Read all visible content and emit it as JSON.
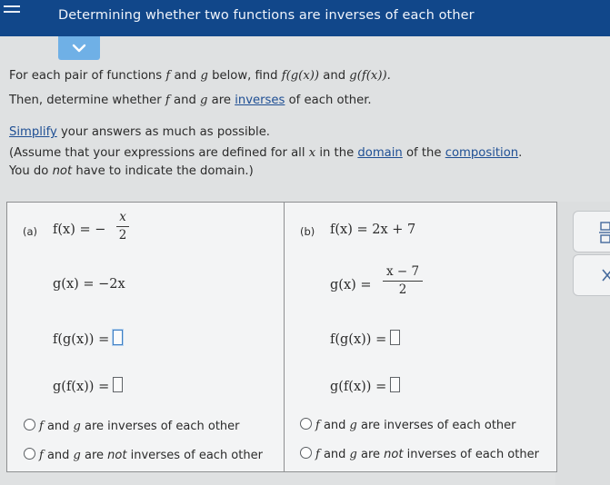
{
  "header": {
    "title": "Determining whether two functions are inverses of each other"
  },
  "intro": {
    "line1_a": "For each pair of functions ",
    "f": "f",
    "and": " and ",
    "g": "g",
    "line1_b": " below, find ",
    "fg_expr": "f(g(x))",
    "line1_c": " and ",
    "gf_expr": "g(f(x)).",
    "line2_a": "Then, determine whether ",
    "line2_b": " are ",
    "inverses_link": "inverses",
    "line2_c": " of each other."
  },
  "notes": {
    "simplify_link": "Simplify",
    "simplify_rest": " your answers as much as possible.",
    "assume_a": "(Assume that your expressions are defined for all ",
    "x": "x",
    "assume_b": " in the ",
    "domain_link": "domain",
    "assume_c": " of the ",
    "composition_link": "composition",
    "assume_d": ".",
    "line3_a": "You do ",
    "not": "not",
    "line3_b": " have to indicate the domain.)"
  },
  "part_a": {
    "tag": "(a)",
    "f_def": "f(x) = −",
    "f_num": "x",
    "f_den": "2",
    "g_def": "g(x) = −2x",
    "fg_label": "f(g(x)) =",
    "gf_label": "g(f(x)) ="
  },
  "part_b": {
    "tag": "(b)",
    "f_def": "f(x) = 2x + 7",
    "g_def": "g(x) =",
    "g_num": "x − 7",
    "g_den": "2",
    "fg_label": "f(g(x)) =",
    "gf_label": "g(f(x)) ="
  },
  "options": {
    "f": "f",
    "g": "g",
    "are_inverses": " are inverses of each other",
    "are": " are ",
    "not": "not",
    "inverses_tail": " inverses of each other",
    "and": " and "
  }
}
